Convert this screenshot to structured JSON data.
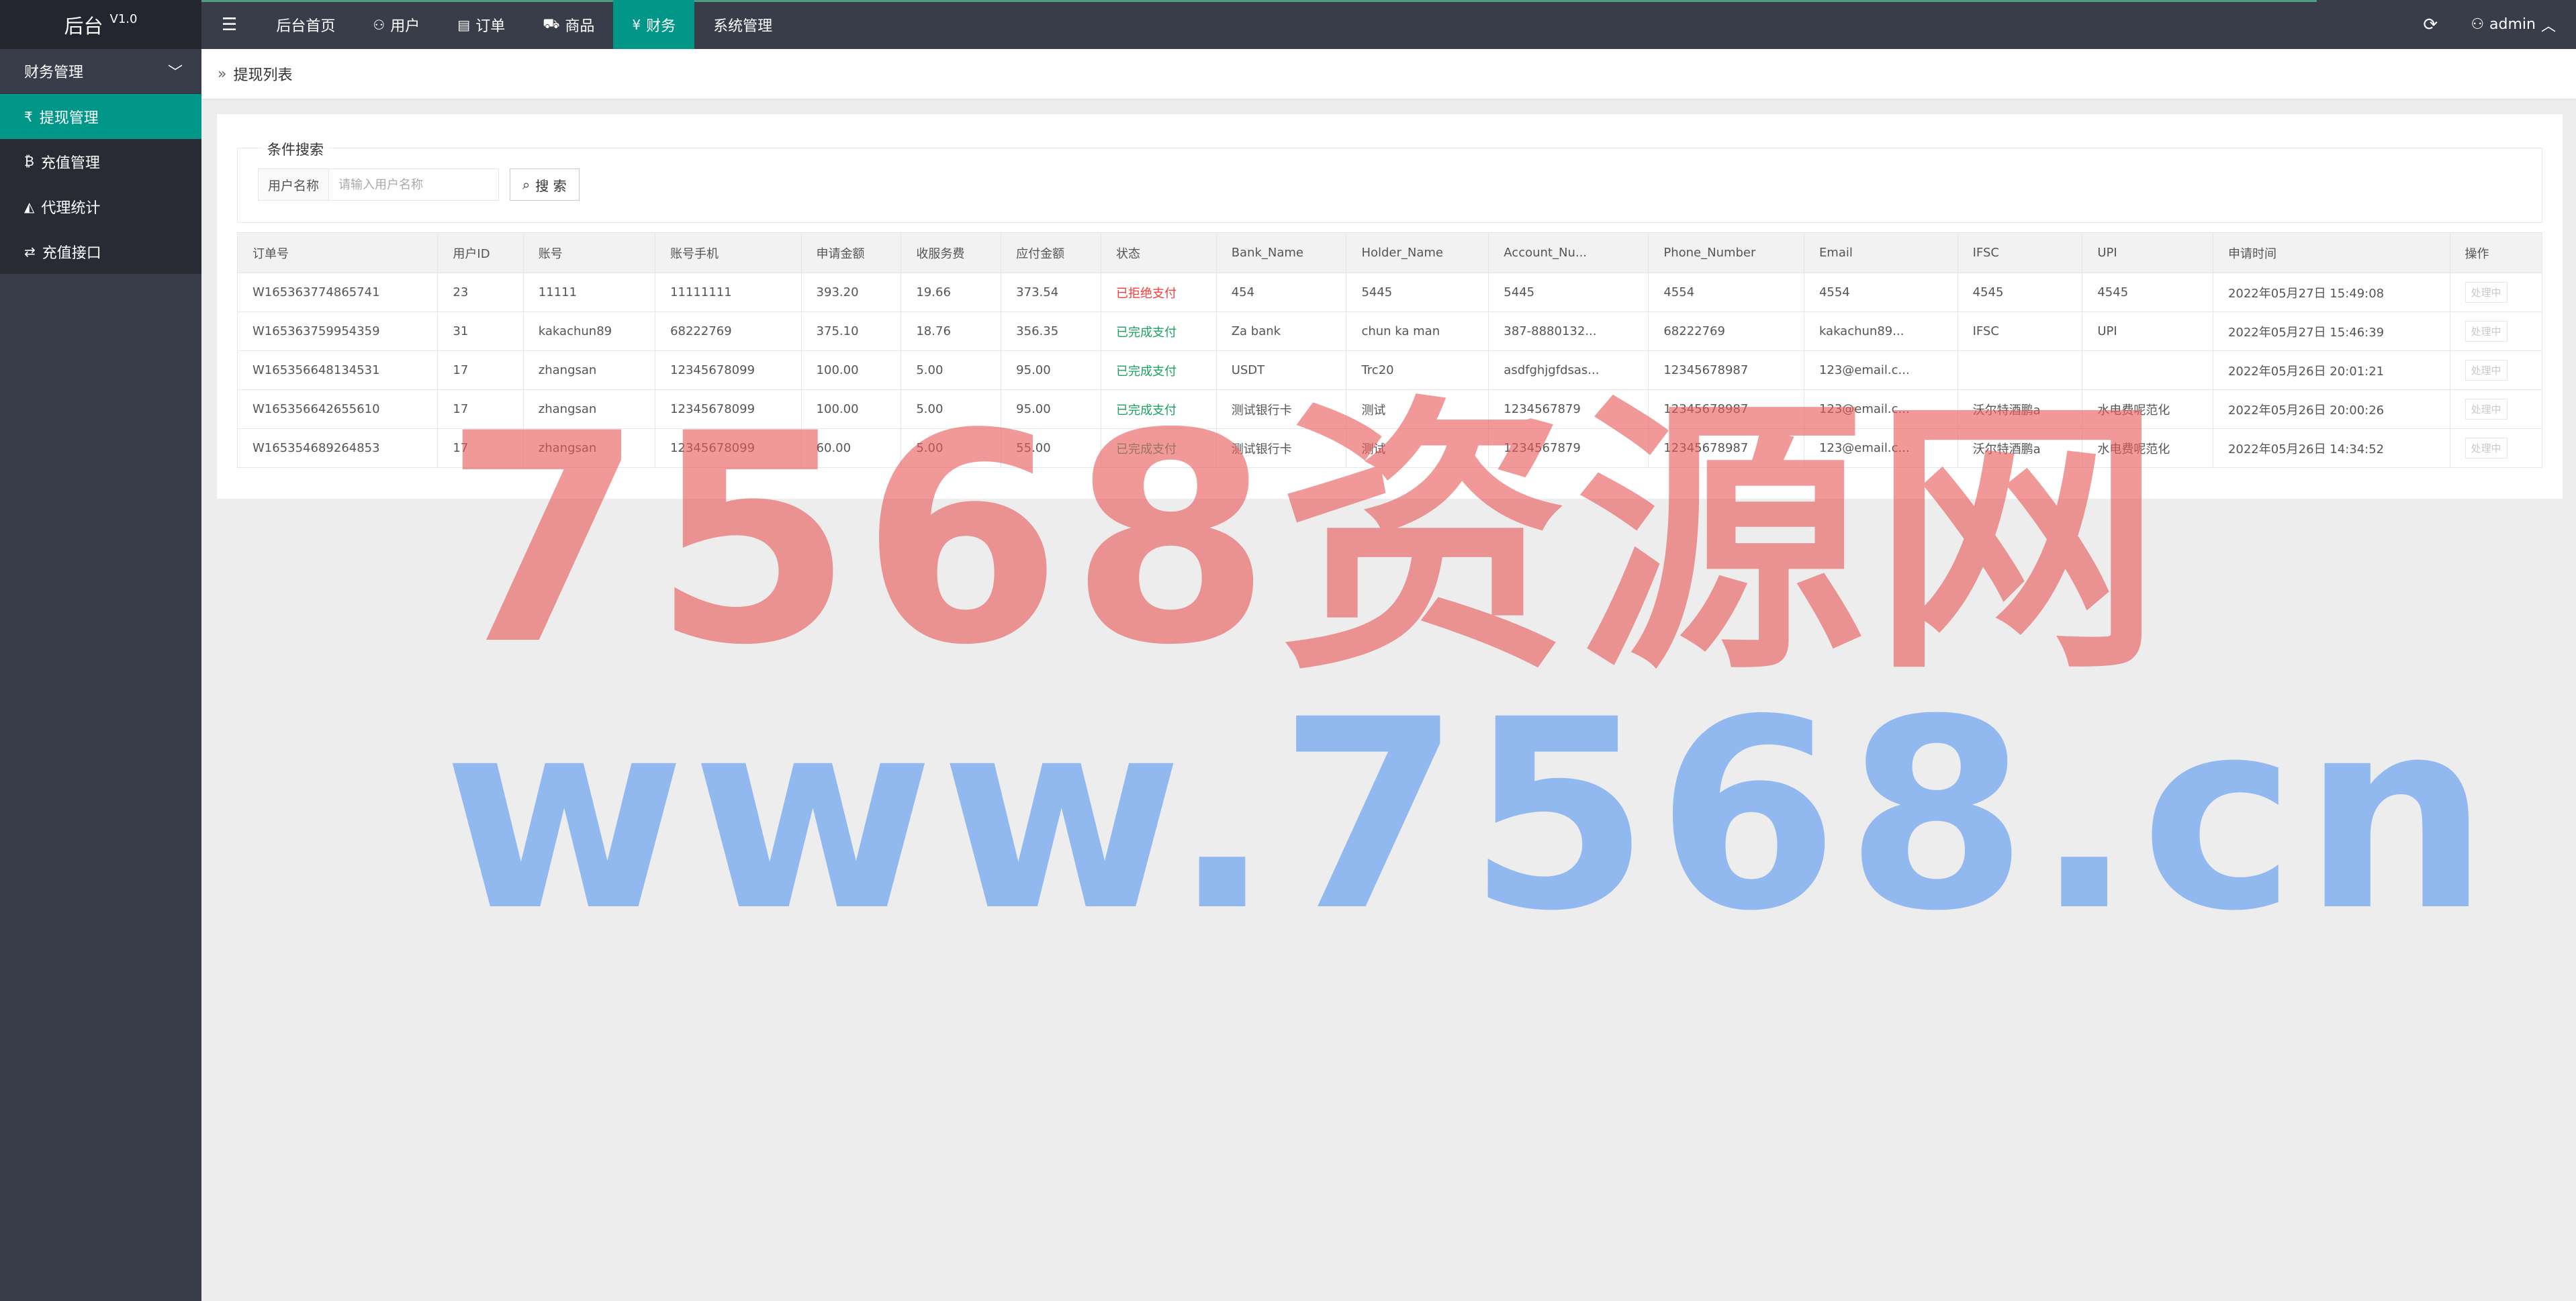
{
  "app": {
    "name": "后台",
    "version": "V1.0"
  },
  "topnav": {
    "items": [
      {
        "label": "后台首页"
      },
      {
        "label": "用户"
      },
      {
        "label": "订单"
      },
      {
        "label": "商品"
      },
      {
        "label": "财务"
      },
      {
        "label": "系统管理"
      }
    ]
  },
  "user": {
    "name": "admin"
  },
  "sidebar": {
    "group": "财务管理",
    "items": [
      {
        "label": "提现管理"
      },
      {
        "label": "充值管理"
      },
      {
        "label": "代理统计"
      },
      {
        "label": "充值接口"
      }
    ]
  },
  "breadcrumb": "提现列表",
  "search": {
    "legend": "条件搜索",
    "label": "用户名称",
    "placeholder": "请输入用户名称",
    "button": "搜 索"
  },
  "table": {
    "headers": [
      "订单号",
      "用户ID",
      "账号",
      "账号手机",
      "申请金额",
      "收服务费",
      "应付金额",
      "状态",
      "Bank_Name",
      "Holder_Name",
      "Account_Nu...",
      "Phone_Number",
      "Email",
      "IFSC",
      "UPI",
      "申请时间",
      "操作"
    ],
    "rows": [
      [
        "W165363774865741",
        "23",
        "11111",
        "11111111",
        "393.20",
        "19.66",
        "373.54",
        "已拒绝支付",
        "454",
        "5445",
        "5445",
        "4554",
        "4554",
        "4545",
        "4545",
        "2022年05月27日 15:49:08",
        "处理中"
      ],
      [
        "W165363759954359",
        "31",
        "kakachun89",
        "68222769",
        "375.10",
        "18.76",
        "356.35",
        "已完成支付",
        "Za bank",
        "chun ka man",
        "387-8880132...",
        "68222769",
        "kakachun89...",
        "IFSC",
        "UPI",
        "2022年05月27日 15:46:39",
        "处理中"
      ],
      [
        "W165356648134531",
        "17",
        "zhangsan",
        "12345678099",
        "100.00",
        "5.00",
        "95.00",
        "已完成支付",
        "USDT",
        "Trc20",
        "asdfghjgfdsas...",
        "12345678987",
        "123@email.c...",
        "",
        "",
        "2022年05月26日 20:01:21",
        "处理中"
      ],
      [
        "W165356642655610",
        "17",
        "zhangsan",
        "12345678099",
        "100.00",
        "5.00",
        "95.00",
        "已完成支付",
        "测试银行卡",
        "测试",
        "1234567879",
        "12345678987",
        "123@email.c...",
        "沃尔特酒鹏a",
        "水电费呢范化",
        "2022年05月26日 20:00:26",
        "处理中"
      ],
      [
        "W165354689264853",
        "17",
        "zhangsan",
        "12345678099",
        "60.00",
        "5.00",
        "55.00",
        "已完成支付",
        "测试银行卡",
        "测试",
        "1234567879",
        "12345678987",
        "123@email.c...",
        "沃尔特酒鹏a",
        "水电费呢范化",
        "2022年05月26日 14:34:52",
        "处理中"
      ]
    ],
    "status_colors": {
      "已拒绝支付": "#ff3a3a",
      "已完成支付": "#1aa260"
    }
  },
  "watermark": {
    "line1": "7568资源网",
    "line2": "www.7568.cn"
  },
  "colors": {
    "accent": "#009688",
    "topbar": "#393d49",
    "sidebar": "#393d49"
  }
}
